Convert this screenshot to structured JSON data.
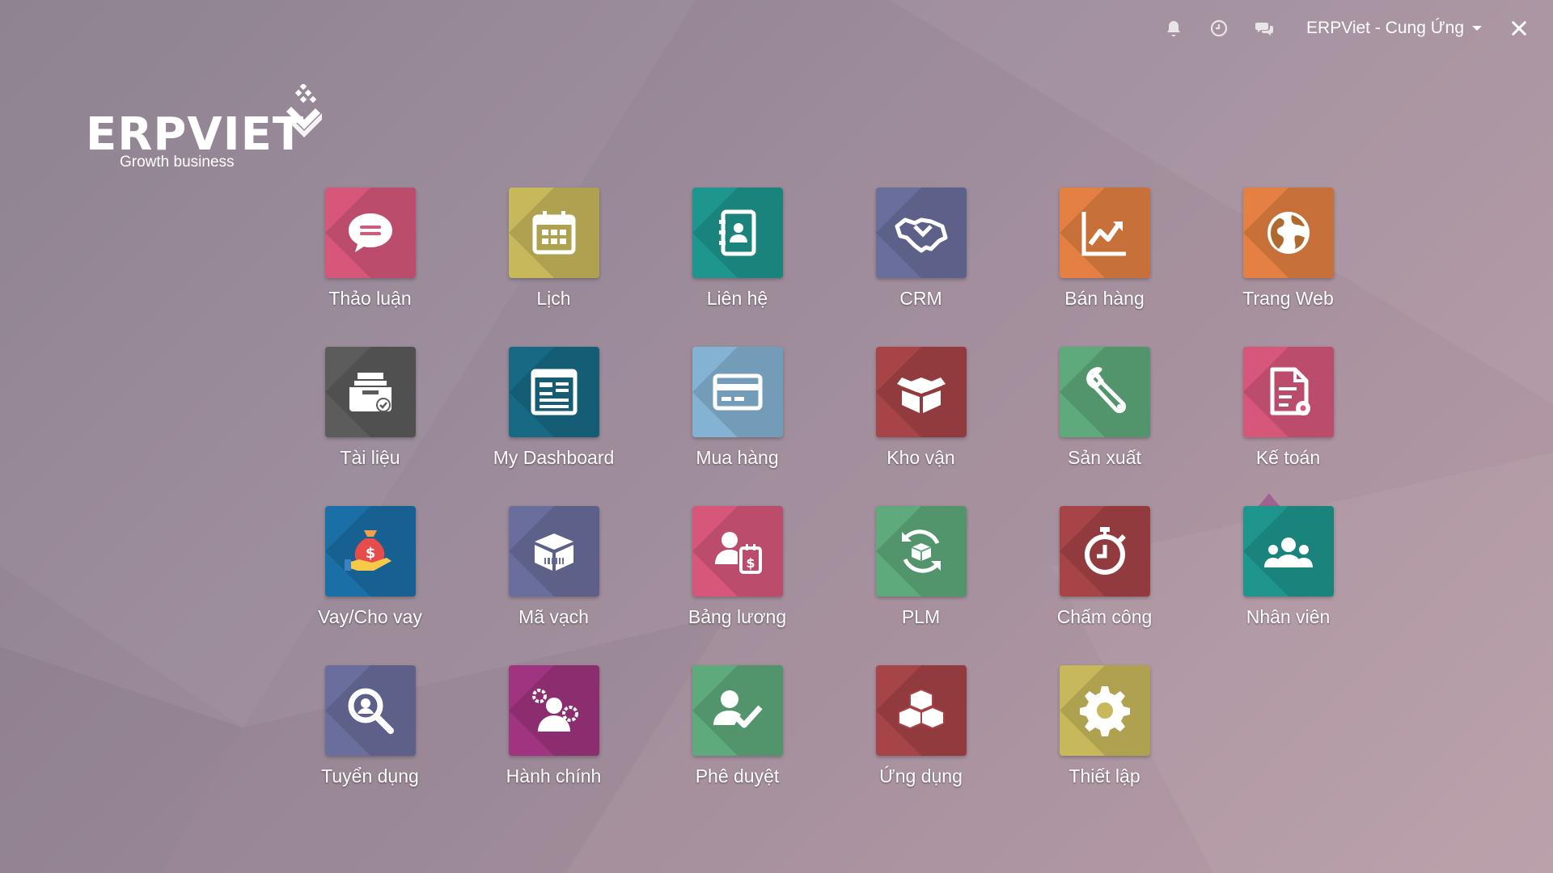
{
  "topbar": {
    "icons": [
      "bell-icon",
      "clock-icon",
      "chat-icon",
      "close-icon"
    ],
    "company": "ERPViet - Cung Ứng"
  },
  "logo": {
    "name": "ERPVIET",
    "tagline": "Growth business"
  },
  "apps": [
    {
      "label": "Thảo luận",
      "icon": "chat-bubble-icon",
      "color": "#d6577a"
    },
    {
      "label": "Lịch",
      "icon": "calendar-icon",
      "color": "#c7b85c"
    },
    {
      "label": "Liên hệ",
      "icon": "contact-book-icon",
      "color": "#1e968e"
    },
    {
      "label": "CRM",
      "icon": "handshake-icon",
      "color": "#6a6e9c"
    },
    {
      "label": "Bán hàng",
      "icon": "sales-chart-icon",
      "color": "#e48043"
    },
    {
      "label": "Trang Web",
      "icon": "globe-icon",
      "color": "#e48043"
    },
    {
      "label": "Tài liệu",
      "icon": "document-tray-icon",
      "color": "#5c5c5c"
    },
    {
      "label": "My Dashboard",
      "icon": "dashboard-icon",
      "color": "#186a84"
    },
    {
      "label": "Mua hàng",
      "icon": "credit-card-icon",
      "color": "#83b2d2"
    },
    {
      "label": "Kho vận",
      "icon": "box-icon",
      "color": "#a64447"
    },
    {
      "label": "Sản xuất",
      "icon": "wrench-icon",
      "color": "#5eaa7c"
    },
    {
      "label": "Kế toán",
      "icon": "invoice-settings-icon",
      "color": "#d6577a"
    },
    {
      "label": "Vay/Cho vay",
      "icon": "money-bag-hand-icon",
      "color": "#1a6fa6"
    },
    {
      "label": "Mã vạch",
      "icon": "barcode-box-icon",
      "color": "#6a6e9c"
    },
    {
      "label": "Bảng lương",
      "icon": "payroll-icon",
      "color": "#d6577a"
    },
    {
      "label": "PLM",
      "icon": "product-cycle-icon",
      "color": "#5eaa7c"
    },
    {
      "label": "Chấm công",
      "icon": "stopwatch-icon",
      "color": "#a64447"
    },
    {
      "label": "Nhân viên",
      "icon": "employees-icon",
      "color": "#1e968e"
    },
    {
      "label": "Tuyển dụng",
      "icon": "magnifier-icon",
      "color": "#6a6e9c"
    },
    {
      "label": "Hành chính",
      "icon": "admin-gears-icon",
      "color": "#a03480"
    },
    {
      "label": "Phê duyệt",
      "icon": "user-check-icon",
      "color": "#5eaa7c"
    },
    {
      "label": "Ứng dụng",
      "icon": "cubes-icon",
      "color": "#a64447"
    },
    {
      "label": "Thiết lập",
      "icon": "gear-icon",
      "color": "#c7b85c"
    }
  ]
}
